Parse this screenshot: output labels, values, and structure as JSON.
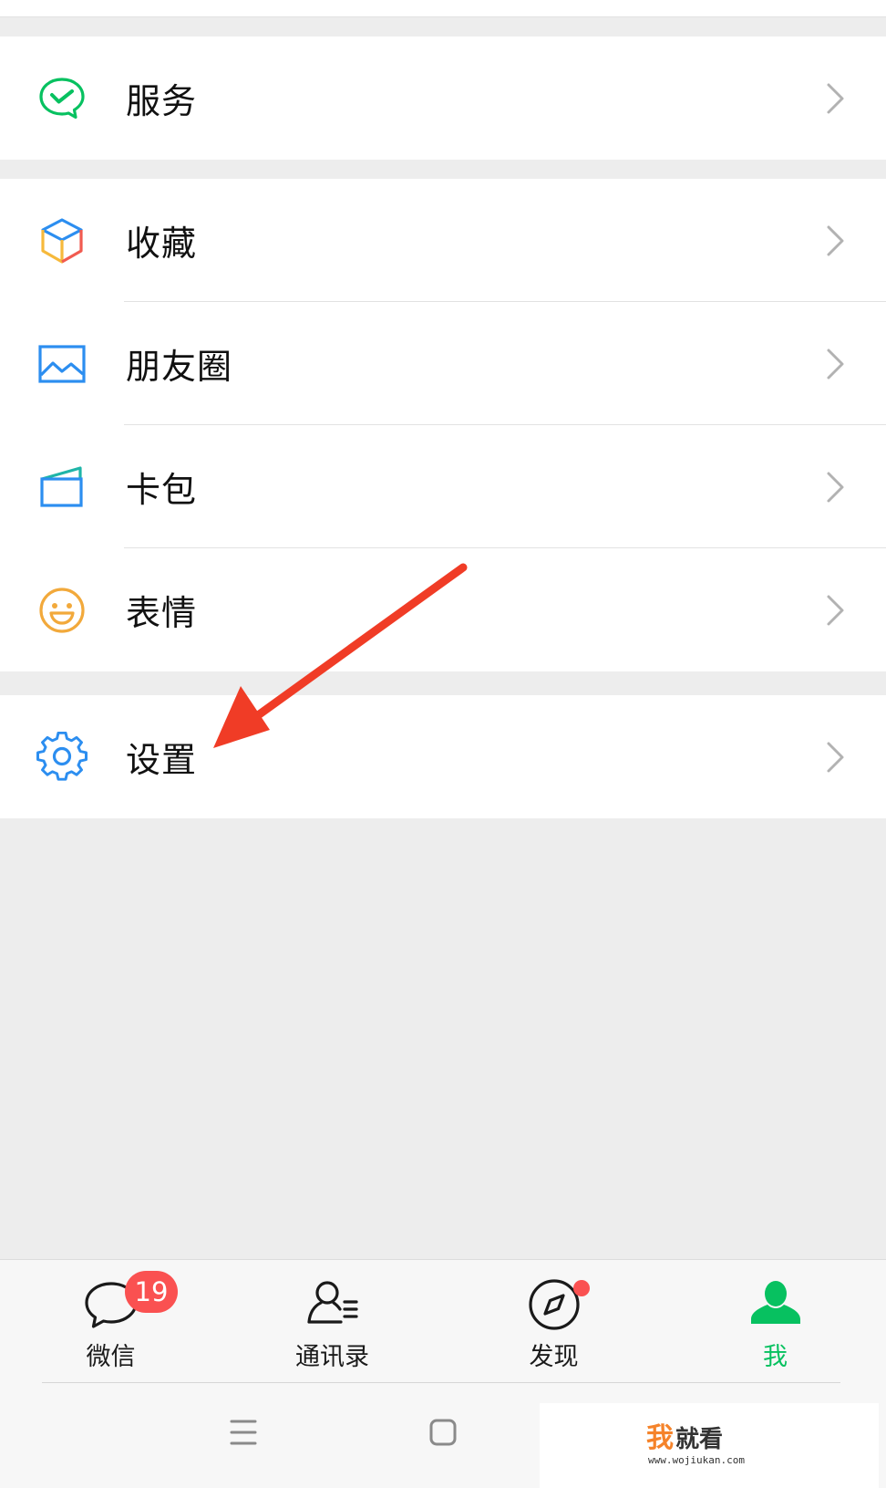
{
  "menu": {
    "service": {
      "label": "服务",
      "icon": "wechat-pay-icon"
    },
    "favorites": {
      "label": "收藏",
      "icon": "favorites-cube-icon"
    },
    "moments": {
      "label": "朋友圈",
      "icon": "photo-icon"
    },
    "cards": {
      "label": "卡包",
      "icon": "card-wallet-icon"
    },
    "stickers": {
      "label": "表情",
      "icon": "smiley-icon"
    },
    "settings": {
      "label": "设置",
      "icon": "gear-icon"
    }
  },
  "tabbar": {
    "tabs": [
      {
        "label": "微信",
        "icon": "chat-bubble-icon",
        "badge": "19"
      },
      {
        "label": "通讯录",
        "icon": "contacts-icon"
      },
      {
        "label": "发现",
        "icon": "compass-icon",
        "dot": true
      },
      {
        "label": "我",
        "icon": "person-icon",
        "active": true
      }
    ]
  },
  "colors": {
    "accent_green": "#07c160",
    "badge_red": "#fa5151",
    "arrow_red": "#f03c26",
    "background": "#ededed"
  },
  "navigation": {
    "buttons": [
      "menu-icon",
      "home-square-icon"
    ]
  },
  "watermark": {
    "text": "我就看",
    "url": "www.wojiukan.com"
  }
}
